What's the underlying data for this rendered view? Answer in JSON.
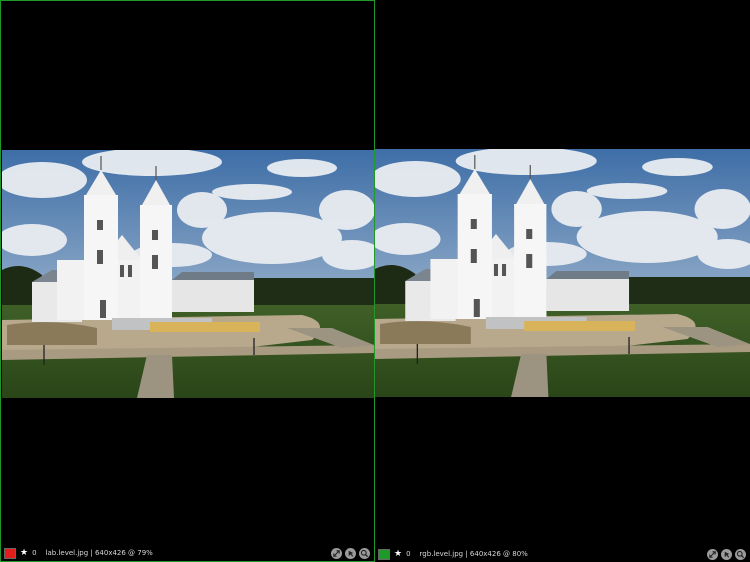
{
  "panes": [
    {
      "swatch_color": "#e01e1e",
      "star_icon": "star-icon",
      "rating": "0",
      "caption": "lab.level.jpg | 640x426 @ 79%"
    },
    {
      "swatch_color": "#1f9a2a",
      "star_icon": "star-icon",
      "rating": "0",
      "caption": "rgb.level.jpg | 640x426 @ 80%"
    }
  ],
  "tool_icons": [
    "expand-icon",
    "pointer-icon",
    "zoom-icon"
  ]
}
